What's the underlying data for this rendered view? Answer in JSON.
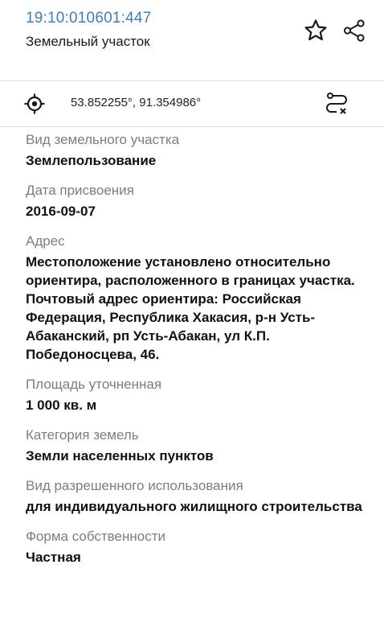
{
  "header": {
    "cadastral_number": "19:10:010601:447",
    "subtitle": "Земельный участок",
    "star_icon": "star-icon",
    "share_icon": "share-icon"
  },
  "coordinates": {
    "text": "53.852255°, 91.354986°",
    "locate_icon": "crosshair-icon",
    "route_icon": "route-icon"
  },
  "fields": [
    {
      "label": "Вид земельного участка",
      "value": "Землепользование"
    },
    {
      "label": "Дата присвоения",
      "value": "2016-09-07"
    },
    {
      "label": "Адрес",
      "value": "Местоположение установлено относительно ориентира, расположенного в границах участка. Почтовый адрес ориентира: Российская Федерация, Республика Хакасия, р-н Усть-Абаканский, рп Усть-Абакан, ул К.П. Победоносцева, 46."
    },
    {
      "label": "Площадь уточненная",
      "value": "1 000 кв. м"
    },
    {
      "label": "Категория земель",
      "value": "Земли населенных пунктов"
    },
    {
      "label": "Вид разрешенного использования",
      "value": "для индивидуального жилищного строительства"
    },
    {
      "label": "Форма собственности",
      "value": "Частная"
    }
  ]
}
